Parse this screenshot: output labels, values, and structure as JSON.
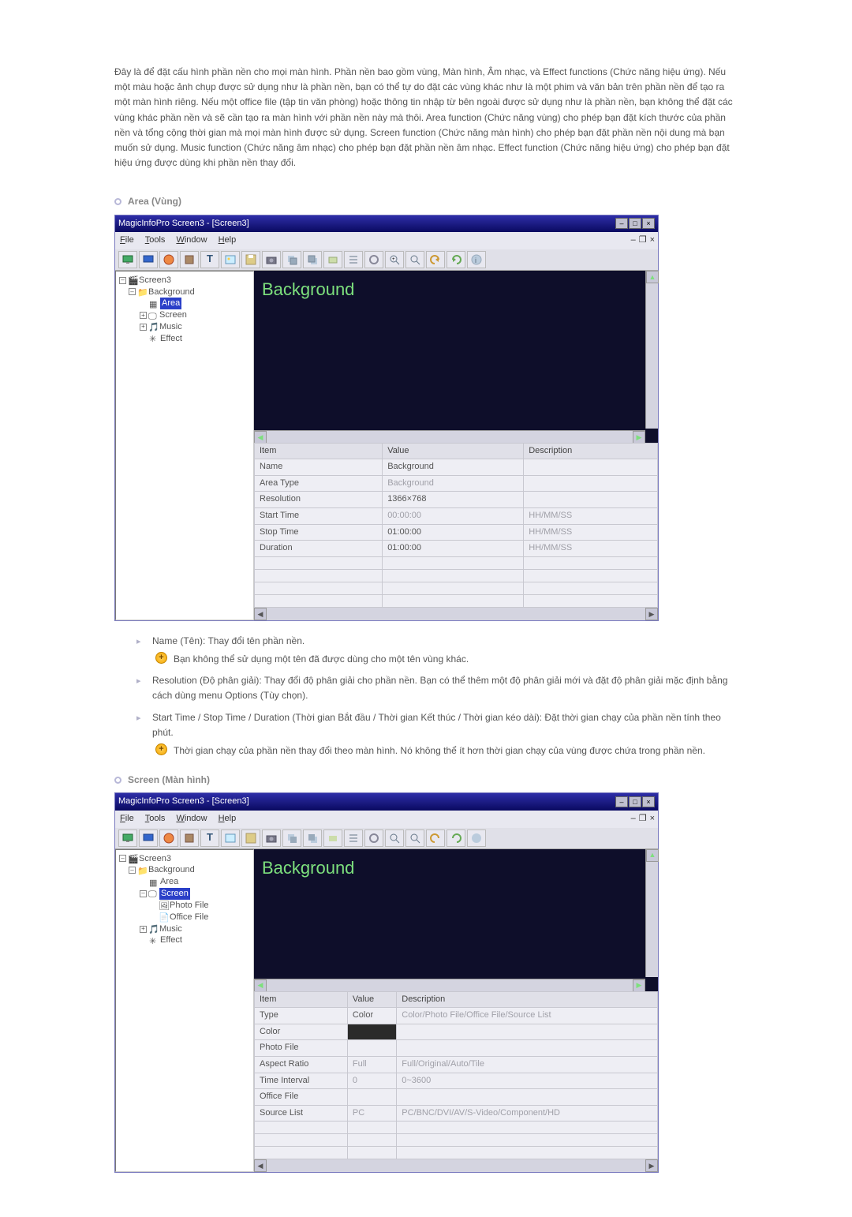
{
  "intro": "Đây là để đặt cấu hình phần nền cho mọi màn hình. Phần nền bao gồm vùng, Màn hình, Âm nhạc, và Effect functions (Chức năng hiệu ứng). Nếu một màu hoặc ảnh chụp được sử dụng như là phần nền, bạn có thể tự do đặt các vùng khác như là một phim và văn bản trên phần nền để tạo ra một màn hình riêng. Nếu một office file (tập tin văn phòng) hoặc thông tin nhập từ bên ngoài được sử dụng như là phần nền, bạn không thể đặt các vùng khác phần nền và sẽ cần tạo ra màn hình với phần nền này mà thôi. Area function (Chức năng vùng) cho phép bạn đặt kích thước của phần nền và tổng cộng thời gian mà mọi màn hình được sử dụng. Screen function (Chức năng màn hình) cho phép bạn đặt phần nền nội dung mà bạn muốn sử dụng. Music function (Chức năng âm nhạc) cho phép bạn đặt phần nền âm nhạc. Effect function (Chức năng hiệu ứng) cho phép bạn đặt hiệu ứng được dùng khi phần nền thay đổi.",
  "section_area": "Area (Vùng)",
  "section_screen": "Screen (Màn hình)",
  "app": {
    "title": "MagicInfoPro Screen3 - [Screen3]",
    "menu": {
      "file": "File",
      "tools": "Tools",
      "window": "Window",
      "help": "Help"
    },
    "preview_label": "Background"
  },
  "tree_area": {
    "n0": "Screen3",
    "n1": "Background",
    "n2": "Area",
    "n3": "Screen",
    "n4": "Music",
    "n5": "Effect"
  },
  "tree_screen": {
    "n0": "Screen3",
    "n1": "Background",
    "n2": "Area",
    "n3": "Screen",
    "n4": "Photo File",
    "n5": "Office File",
    "n6": "Music",
    "n7": "Effect"
  },
  "props_header": {
    "item": "Item",
    "value": "Value",
    "desc": "Description"
  },
  "props_area": [
    {
      "item": "Name",
      "value": "Background",
      "desc": ""
    },
    {
      "item": "Area Type",
      "value": "Background",
      "desc": "",
      "grey": true
    },
    {
      "item": "Resolution",
      "value": "1366×768",
      "desc": ""
    },
    {
      "item": "Start Time",
      "value": "00:00:00",
      "desc": "HH/MM/SS",
      "grey": true
    },
    {
      "item": "Stop Time",
      "value": "01:00:00",
      "desc": "HH/MM/SS"
    },
    {
      "item": "Duration",
      "value": "01:00:00",
      "desc": "HH/MM/SS"
    }
  ],
  "props_screen": [
    {
      "item": "Type",
      "value": "Color",
      "desc": "Color/Photo File/Office File/Source List"
    },
    {
      "item": "Color",
      "value": "",
      "desc": "",
      "dark": true
    },
    {
      "item": "Photo File",
      "value": "",
      "desc": ""
    },
    {
      "item": "Aspect Ratio",
      "value": "Full",
      "desc": "Full/Original/Auto/Tile",
      "grey": true
    },
    {
      "item": "Time Interval",
      "value": "0",
      "desc": "0~3600",
      "grey": true
    },
    {
      "item": "Office File",
      "value": "",
      "desc": ""
    },
    {
      "item": "Source List",
      "value": "PC",
      "desc": "PC/BNC/DVI/AV/S-Video/Component/HD",
      "grey": true
    }
  ],
  "notes_area": {
    "n1_main": "Name (Tên): Thay đổi tên phần nền.",
    "n1_sub": "Bạn không thể sử dụng một tên đã được dùng cho một tên vùng khác.",
    "n2_main": "Resolution (Độ phân giải): Thay đổi độ phân giải cho phần nền. Bạn có thể thêm một độ phân giải mới và đặt độ phân giải mặc định bằng cách dùng menu Options (Tùy chọn).",
    "n3_main": "Start Time / Stop Time / Duration (Thời gian Bắt đầu / Thời gian Kết thúc / Thời gian kéo dài): Đặt thời gian chạy của phần nền tính theo phút.",
    "n3_sub": "Thời gian chạy của phần nền thay đổi theo màn hình. Nó không thể ít hơn thời gian chạy của vùng được chứa trong phần nền."
  }
}
